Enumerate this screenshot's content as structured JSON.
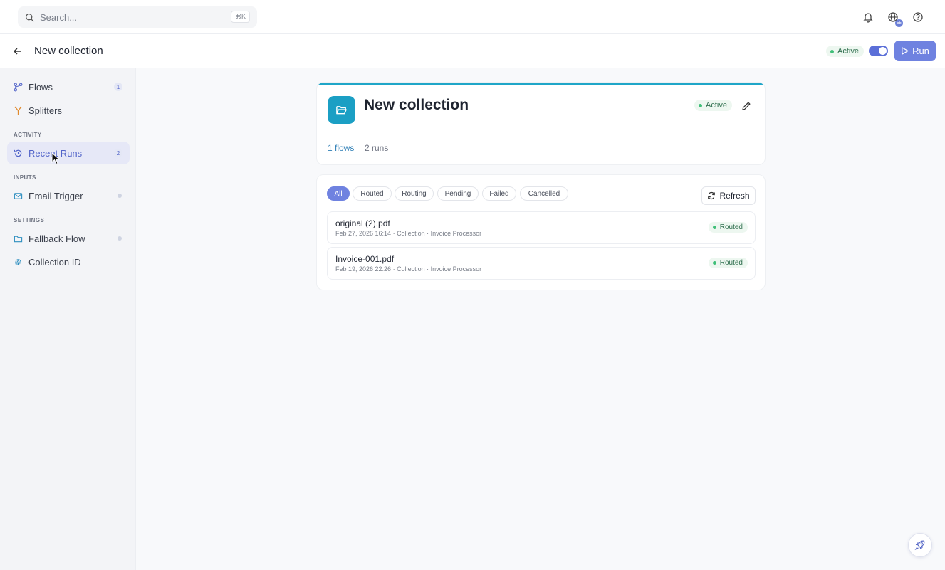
{
  "search": {
    "placeholder": "Search...",
    "shortcut": "⌘K"
  },
  "topbar": {
    "globe_badge": "55",
    "icons": [
      "bell-icon",
      "globe-icon",
      "help-icon"
    ]
  },
  "header": {
    "title": "New collection",
    "status": "Active",
    "toggle_on": true,
    "run_label": "Run"
  },
  "sidebar": {
    "items": [
      {
        "label": "Flows",
        "count": "1",
        "icon": "flows-icon"
      },
      {
        "label": "Splitters",
        "icon": "splitter-icon"
      }
    ],
    "sections": [
      {
        "label": "ACTIVITY",
        "items": [
          {
            "label": "Recent Runs",
            "count": "2",
            "icon": "history-icon",
            "active": true
          }
        ]
      },
      {
        "label": "INPUTS",
        "items": [
          {
            "label": "Email Trigger",
            "icon": "mail-icon"
          }
        ]
      },
      {
        "label": "SETTINGS",
        "items": [
          {
            "label": "Fallback Flow",
            "icon": "folder-icon"
          },
          {
            "label": "Collection ID",
            "icon": "fingerprint-icon"
          }
        ]
      }
    ]
  },
  "collection": {
    "title": "New collection",
    "status": "Active",
    "flows_link": "1 flows",
    "runs_text": "2 runs",
    "accent_color": "#1fa6c8"
  },
  "filters": {
    "tabs": [
      "All",
      "Routed",
      "Routing",
      "Pending",
      "Failed",
      "Cancelled"
    ],
    "selected": "All",
    "refresh_label": "Refresh"
  },
  "runs": [
    {
      "name": "original (2).pdf",
      "meta": "Feb 27, 2026 16:14 · Collection · Invoice Processor",
      "status": "Routed"
    },
    {
      "name": "Invoice-001.pdf",
      "meta": "Feb 19, 2026 22:26 · Collection · Invoice Processor",
      "status": "Routed"
    }
  ],
  "colors": {
    "brand": "#6f82e0",
    "status_green": "#3fbf78",
    "active_nav": "#5264c9"
  }
}
